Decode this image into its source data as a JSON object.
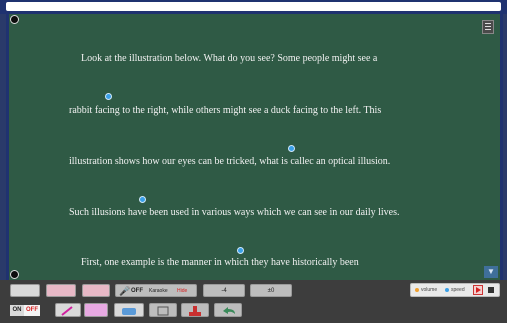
{
  "text_lines": [
    "Look at the illustration below.  What do you see?  Some people might see a",
    "rabbit facing to the right, while others might see a duck facing to the left.  This",
    "illustration shows how our eyes can be tricked, what is callec an optical illusion.",
    "Such illusions have been used in various ways which we can see in our daily lives.",
    "First, one example is the manner in which they have historically been"
  ],
  "toolbar": {
    "mic_off_label": "OFF",
    "karaoke_label": "Karaoke",
    "hide_label": "Hide",
    "font_size_value": "-4",
    "line_spacing_value": "±0",
    "on_label": "ON",
    "off_label": "OFF"
  },
  "recorder": {
    "volume_label": "volume",
    "speed_label": "speed"
  },
  "colors": {
    "board": "#2f5a45",
    "frame": "#1f3270",
    "dot": "#3aa0e8",
    "toolbar": "#3d3d3d"
  }
}
